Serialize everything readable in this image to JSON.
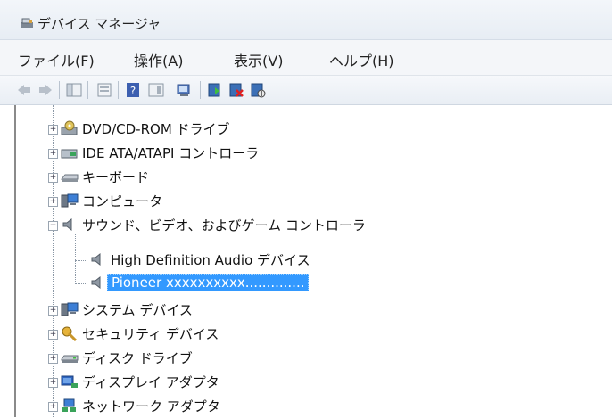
{
  "window": {
    "title": "デバイス マネージャ"
  },
  "menu": [
    {
      "label": "ファイル(F)"
    },
    {
      "label": "操作(A)"
    },
    {
      "label": "表示(V)"
    },
    {
      "label": "ヘルプ(H)"
    }
  ],
  "tree": {
    "items": [
      {
        "label": "DVD/CD-ROM ドライブ",
        "icon": "dvd-drive-icon"
      },
      {
        "label": "IDE ATA/ATAPI コントローラ",
        "icon": "ide-controller-icon"
      },
      {
        "label": "キーボード",
        "icon": "keyboard-icon"
      },
      {
        "label": "コンピュータ",
        "icon": "computer-icon"
      },
      {
        "label": "サウンド、ビデオ、およびゲーム コントローラ",
        "icon": "speaker-icon",
        "expanded": true,
        "children": [
          {
            "label": "High Definition Audio デバイス",
            "icon": "speaker-icon"
          },
          {
            "label": "Pioneer xxxxxxxxxx..............",
            "icon": "speaker-icon",
            "selected": true
          }
        ]
      },
      {
        "label": "システム デバイス",
        "icon": "system-device-icon"
      },
      {
        "label": "セキュリティ デバイス",
        "icon": "security-device-icon"
      },
      {
        "label": "ディスク ドライブ",
        "icon": "disk-drive-icon"
      },
      {
        "label": "ディスプレイ アダプタ",
        "icon": "display-adapter-icon"
      },
      {
        "label": "ネットワーク アダプタ",
        "icon": "network-adapter-icon"
      }
    ]
  }
}
